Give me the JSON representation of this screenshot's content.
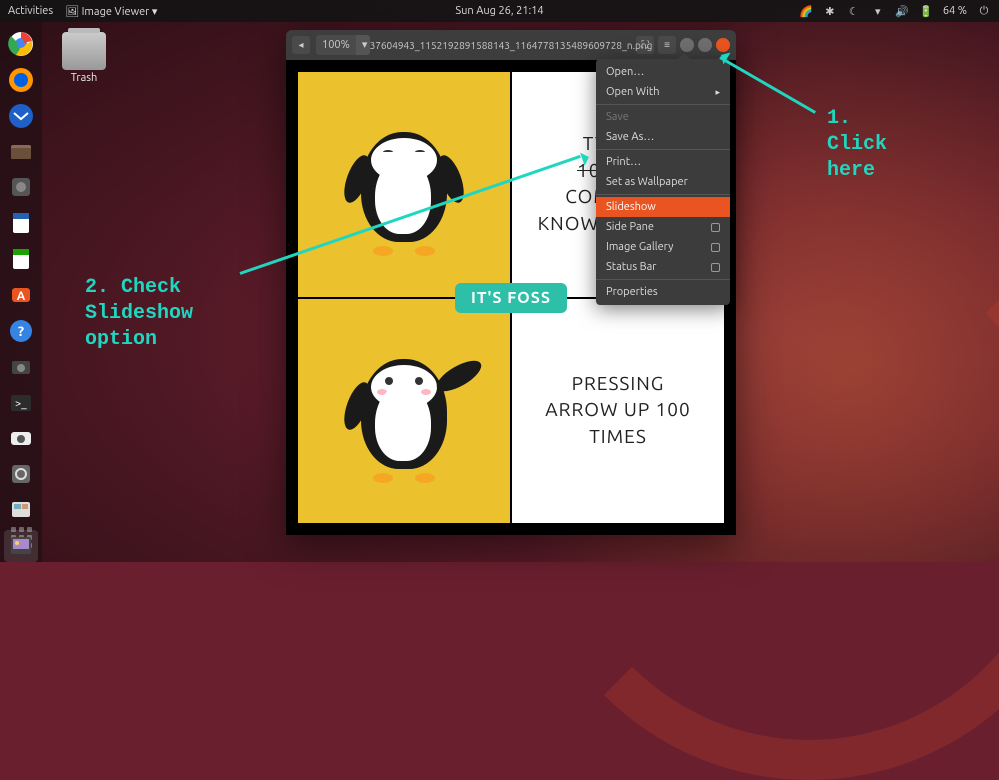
{
  "topbar": {
    "activities": "Activities",
    "app": "Image Viewer ▾",
    "datetime": "Sun Aug 26, 21:14",
    "battery": "64 %"
  },
  "desktop": {
    "trash_label": "Trash"
  },
  "window": {
    "zoom": "100%",
    "title": "37604943_1152192891588143_1164778135489609728_n.png"
  },
  "meme": {
    "tl_line1": "TYPING",
    "tl_line2_strike": "10 CHAR",
    "tl_line3": "COMMAND",
    "tl_line4": "KNOW BY HEART",
    "br_line1": "PRESSING",
    "br_line2": "ARROW UP 100",
    "br_line3": "TIMES",
    "badge": "IT'S FOSS"
  },
  "menu": {
    "open": "Open…",
    "open_with": "Open With",
    "save": "Save",
    "save_as": "Save As…",
    "print": "Print…",
    "wallpaper": "Set as Wallpaper",
    "slideshow": "Slideshow",
    "side_pane": "Side Pane",
    "gallery": "Image Gallery",
    "status": "Status Bar",
    "properties": "Properties"
  },
  "annot": {
    "step1": "1.\nClick\nhere",
    "step2": "2. Check\nSlideshow\noption"
  }
}
